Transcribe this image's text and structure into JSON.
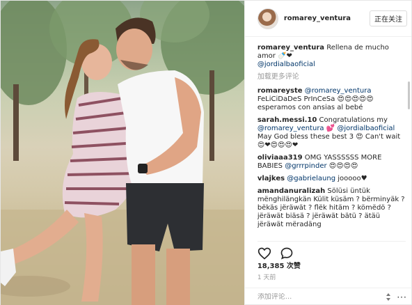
{
  "header": {
    "username": "romarey_ventura",
    "follow_label": "正在关注"
  },
  "caption": {
    "username": "romarey_ventura",
    "text": "Rellena de mucho amor 🍼❤",
    "mention": "@jordialbaoficial"
  },
  "load_more_label": "加载更多评论",
  "comments": [
    {
      "user": "romareyste",
      "mention": "@romarey_ventura",
      "text": "FeLiCiDaDeS PrInCeSa 😍😍😍😍😍 esperamos con ansias al bebé"
    },
    {
      "user": "sarah.messi.10",
      "text": "Congratulations my",
      "mention": "@romarey_ventura",
      "text2": "💕",
      "mention2": "@jordialbaoficial",
      "text3": "May God bless these best 3 😍 Can't wait😍❤😍😍😍❤"
    },
    {
      "user": "oliviaaa319",
      "text": "OMG YASSSSSS MORE BABIES",
      "mention": "@grrrpinder",
      "text2": "😍😍😍😍"
    },
    {
      "user": "vlajkes",
      "mention": "@gabrielaung",
      "text": "jooooo♥"
    },
    {
      "user": "amandanuralizah",
      "text": "Sölüsi üntük mënghilängkän Külit küsäm ? bërminyäk ? bëkäs jëräwät ? flëk hitäm ? kömëdö ? jëräwät biäsä ? jëräwät bätü ? ätäü jëräwät mëradäng"
    }
  ],
  "actions": {
    "like_icon": "heart-icon",
    "comment_icon": "comment-bubble-icon"
  },
  "likes_text": "18,385 次赞",
  "time_ago": "1 天前",
  "add_comment": {
    "placeholder": "添加评论..."
  },
  "more_options": "···"
}
